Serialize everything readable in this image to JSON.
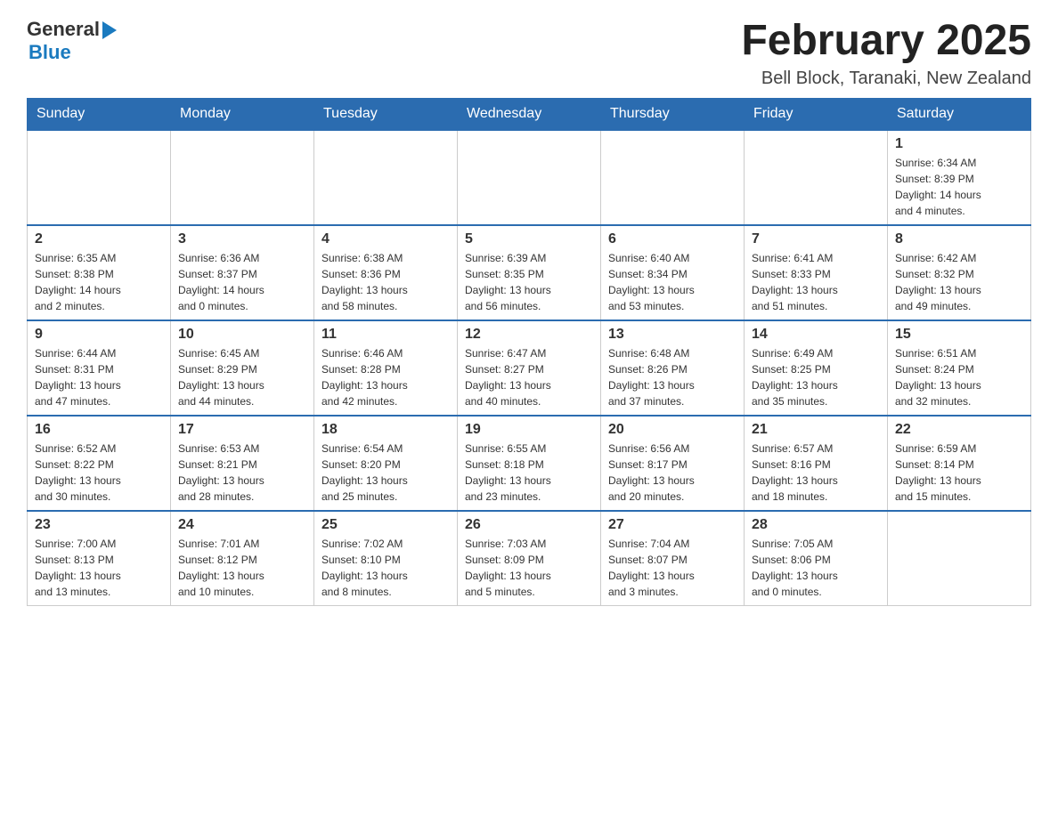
{
  "header": {
    "logo_general": "General",
    "logo_blue": "Blue",
    "month_title": "February 2025",
    "location": "Bell Block, Taranaki, New Zealand"
  },
  "weekdays": [
    "Sunday",
    "Monday",
    "Tuesday",
    "Wednesday",
    "Thursday",
    "Friday",
    "Saturday"
  ],
  "weeks": [
    [
      {
        "day": "",
        "info": ""
      },
      {
        "day": "",
        "info": ""
      },
      {
        "day": "",
        "info": ""
      },
      {
        "day": "",
        "info": ""
      },
      {
        "day": "",
        "info": ""
      },
      {
        "day": "",
        "info": ""
      },
      {
        "day": "1",
        "info": "Sunrise: 6:34 AM\nSunset: 8:39 PM\nDaylight: 14 hours\nand 4 minutes."
      }
    ],
    [
      {
        "day": "2",
        "info": "Sunrise: 6:35 AM\nSunset: 8:38 PM\nDaylight: 14 hours\nand 2 minutes."
      },
      {
        "day": "3",
        "info": "Sunrise: 6:36 AM\nSunset: 8:37 PM\nDaylight: 14 hours\nand 0 minutes."
      },
      {
        "day": "4",
        "info": "Sunrise: 6:38 AM\nSunset: 8:36 PM\nDaylight: 13 hours\nand 58 minutes."
      },
      {
        "day": "5",
        "info": "Sunrise: 6:39 AM\nSunset: 8:35 PM\nDaylight: 13 hours\nand 56 minutes."
      },
      {
        "day": "6",
        "info": "Sunrise: 6:40 AM\nSunset: 8:34 PM\nDaylight: 13 hours\nand 53 minutes."
      },
      {
        "day": "7",
        "info": "Sunrise: 6:41 AM\nSunset: 8:33 PM\nDaylight: 13 hours\nand 51 minutes."
      },
      {
        "day": "8",
        "info": "Sunrise: 6:42 AM\nSunset: 8:32 PM\nDaylight: 13 hours\nand 49 minutes."
      }
    ],
    [
      {
        "day": "9",
        "info": "Sunrise: 6:44 AM\nSunset: 8:31 PM\nDaylight: 13 hours\nand 47 minutes."
      },
      {
        "day": "10",
        "info": "Sunrise: 6:45 AM\nSunset: 8:29 PM\nDaylight: 13 hours\nand 44 minutes."
      },
      {
        "day": "11",
        "info": "Sunrise: 6:46 AM\nSunset: 8:28 PM\nDaylight: 13 hours\nand 42 minutes."
      },
      {
        "day": "12",
        "info": "Sunrise: 6:47 AM\nSunset: 8:27 PM\nDaylight: 13 hours\nand 40 minutes."
      },
      {
        "day": "13",
        "info": "Sunrise: 6:48 AM\nSunset: 8:26 PM\nDaylight: 13 hours\nand 37 minutes."
      },
      {
        "day": "14",
        "info": "Sunrise: 6:49 AM\nSunset: 8:25 PM\nDaylight: 13 hours\nand 35 minutes."
      },
      {
        "day": "15",
        "info": "Sunrise: 6:51 AM\nSunset: 8:24 PM\nDaylight: 13 hours\nand 32 minutes."
      }
    ],
    [
      {
        "day": "16",
        "info": "Sunrise: 6:52 AM\nSunset: 8:22 PM\nDaylight: 13 hours\nand 30 minutes."
      },
      {
        "day": "17",
        "info": "Sunrise: 6:53 AM\nSunset: 8:21 PM\nDaylight: 13 hours\nand 28 minutes."
      },
      {
        "day": "18",
        "info": "Sunrise: 6:54 AM\nSunset: 8:20 PM\nDaylight: 13 hours\nand 25 minutes."
      },
      {
        "day": "19",
        "info": "Sunrise: 6:55 AM\nSunset: 8:18 PM\nDaylight: 13 hours\nand 23 minutes."
      },
      {
        "day": "20",
        "info": "Sunrise: 6:56 AM\nSunset: 8:17 PM\nDaylight: 13 hours\nand 20 minutes."
      },
      {
        "day": "21",
        "info": "Sunrise: 6:57 AM\nSunset: 8:16 PM\nDaylight: 13 hours\nand 18 minutes."
      },
      {
        "day": "22",
        "info": "Sunrise: 6:59 AM\nSunset: 8:14 PM\nDaylight: 13 hours\nand 15 minutes."
      }
    ],
    [
      {
        "day": "23",
        "info": "Sunrise: 7:00 AM\nSunset: 8:13 PM\nDaylight: 13 hours\nand 13 minutes."
      },
      {
        "day": "24",
        "info": "Sunrise: 7:01 AM\nSunset: 8:12 PM\nDaylight: 13 hours\nand 10 minutes."
      },
      {
        "day": "25",
        "info": "Sunrise: 7:02 AM\nSunset: 8:10 PM\nDaylight: 13 hours\nand 8 minutes."
      },
      {
        "day": "26",
        "info": "Sunrise: 7:03 AM\nSunset: 8:09 PM\nDaylight: 13 hours\nand 5 minutes."
      },
      {
        "day": "27",
        "info": "Sunrise: 7:04 AM\nSunset: 8:07 PM\nDaylight: 13 hours\nand 3 minutes."
      },
      {
        "day": "28",
        "info": "Sunrise: 7:05 AM\nSunset: 8:06 PM\nDaylight: 13 hours\nand 0 minutes."
      },
      {
        "day": "",
        "info": ""
      }
    ]
  ]
}
